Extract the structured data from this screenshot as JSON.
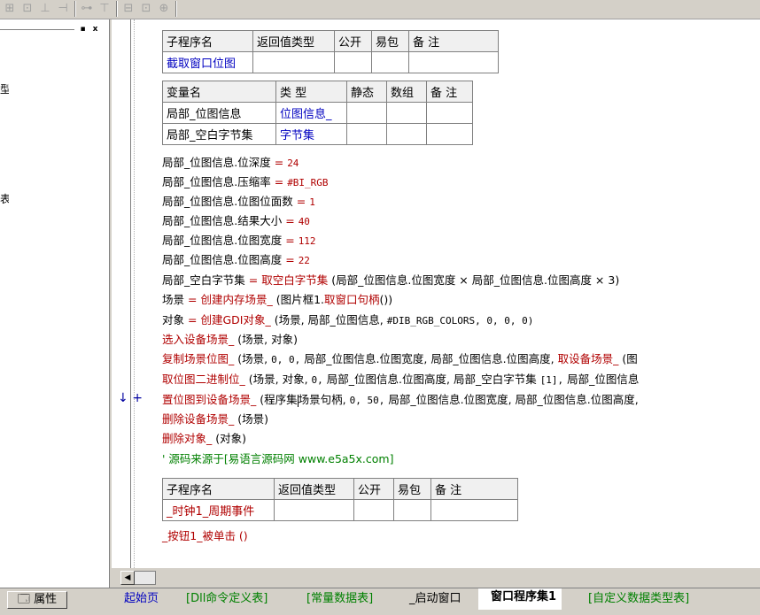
{
  "toolbar": {
    "icons": [
      "align-left-icon",
      "align-top-icon",
      "align-center-icon",
      "align-right-icon",
      "distribute-horizontal-icon",
      "distribute-vertical-icon",
      "same-width-icon",
      "same-height-icon",
      "same-size-icon"
    ]
  },
  "left_pane": {
    "close_glyph": "x",
    "minimize_glyph": "▪",
    "clip1": "型",
    "clip2": "表"
  },
  "sub_table1": {
    "headers": [
      "子程序名",
      "返回值类型",
      "公开",
      "易包",
      "备 注"
    ],
    "row": [
      "截取窗口位图",
      "",
      "",
      "",
      ""
    ]
  },
  "var_table": {
    "headers": [
      "变量名",
      "类 型",
      "静态",
      "数组",
      "备 注"
    ],
    "rows": [
      [
        "局部_位图信息",
        "位图信息_",
        "",
        "",
        ""
      ],
      [
        "局部_空白字节集",
        "字节集",
        "",
        "",
        ""
      ]
    ]
  },
  "code": {
    "l1a": "局部_位图信息.位深度",
    "l1b": "=",
    "l1c": "24",
    "l2a": "局部_位图信息.压缩率",
    "l2b": "=",
    "l2c": "#BI_RGB",
    "l3a": "局部_位图信息.位图位面数",
    "l3b": "=",
    "l3c": "1",
    "l4a": "局部_位图信息.结果大小",
    "l4b": "=",
    "l4c": "40",
    "l5a": "局部_位图信息.位图宽度",
    "l5b": "=",
    "l5c": "112",
    "l6a": "局部_位图信息.位图高度",
    "l6b": "=",
    "l6c": "22",
    "l7a": "局部_空白字节集",
    "l7b": "=",
    "l7c": "取空白字节集",
    "l7d": "(局部_位图信息.位图宽度 × 局部_位图信息.位图高度 × 3)",
    "l8a": "场景",
    "l8b": "=",
    "l8c": "创建内存场景_",
    "l8d": "(图片框1.",
    "l8e": "取窗口句柄",
    "l8f": "())",
    "l9a": "对象",
    "l9b": "=",
    "l9c": "创建GDI对象_",
    "l9d": "(场景, 局部_位图信息,",
    "l9e": "#DIB_RGB_COLORS, 0, 0, 0)",
    "l10a": "选入设备场景_",
    "l10b": "(场景, 对象)",
    "l11a": "复制场景位图_",
    "l11b": "(场景,",
    "l11c": "0, 0,",
    "l11d": "局部_位图信息.位图宽度, 局部_位图信息.位图高度,",
    "l11e": "取设备场景_",
    "l11f": "(图",
    "l12a": "取位图二进制位_",
    "l12b": "(场景, 对象,",
    "l12c": "0,",
    "l12d": "局部_位图信息.位图高度, 局部_空白字节集",
    "l12e": "[1],",
    "l12f": "局部_位图信息",
    "l13a": "置位图到设备场景_",
    "l13b": "(程序集",
    "l13c": "场景句柄,",
    "l13d": "0, 50,",
    "l13e": "局部_位图信息.位图宽度, 局部_位图信息.位图高度,",
    "l14a": "删除设备场景_",
    "l14b": "(场景)",
    "l15a": "删除对象_",
    "l15b": "(对象)",
    "l16": "' 源码来源于[易语言源码网 www.e5a5x.com]"
  },
  "gutter_marks": {
    "arrow": "↓",
    "plus": "+"
  },
  "sub_table2": {
    "headers": [
      "子程序名",
      "返回值类型",
      "公开",
      "易包",
      "备 注"
    ],
    "row": [
      "_时钟1_周期事件",
      "",
      "",
      "",
      ""
    ]
  },
  "after_line": "_按钮1_被单击 ()",
  "hscroll": {
    "left_arrow": "◀"
  },
  "bottom": {
    "prop_label": "属性",
    "tabs": [
      "起始页",
      "[Dll命令定义表]",
      "[常量数据表]",
      "_启动窗口",
      "窗口程序集1",
      "[自定义数据类型表]"
    ],
    "selected_tab": "窗口程序集1"
  }
}
